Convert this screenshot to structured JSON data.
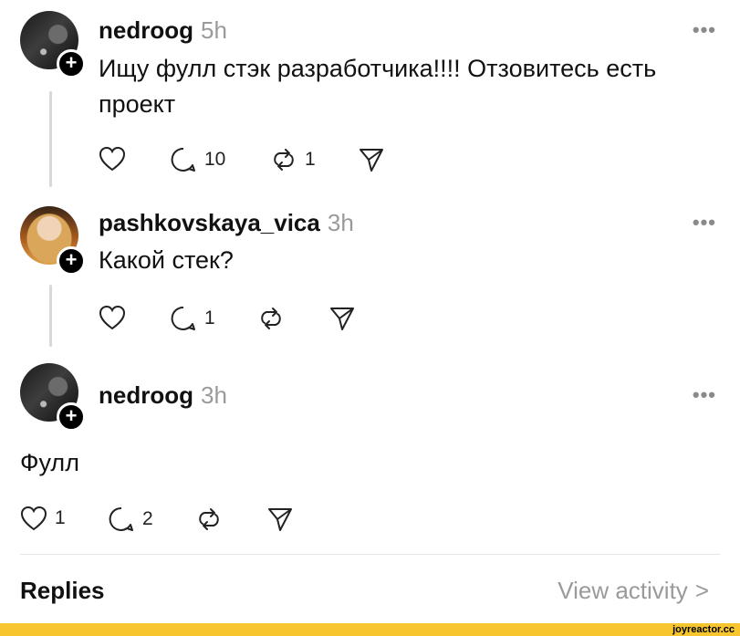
{
  "posts": [
    {
      "username": "nedroog",
      "time": "5h",
      "text": "Ищу фулл стэк разработчика!!!! Отзовитесь есть проект",
      "likes": "",
      "replies": "10",
      "reposts": "1"
    },
    {
      "username": "pashkovskaya_vica",
      "time": "3h",
      "text": "Какой стек?",
      "likes": "",
      "replies": "1",
      "reposts": ""
    },
    {
      "username": "nedroog",
      "time": "3h",
      "text": "Фулл",
      "likes": "1",
      "replies": "2",
      "reposts": ""
    }
  ],
  "more_label": "•••",
  "replies_section": {
    "title": "Replies",
    "view_activity": "View activity",
    "chevron": ">"
  },
  "watermark": "joyreactor.cc",
  "icons": {
    "follow": "plus-icon",
    "like": "heart-icon",
    "reply": "comment-icon",
    "repost": "repost-icon",
    "share": "send-icon",
    "more": "more-dots-icon"
  },
  "colors": {
    "accent": "#000000",
    "muted": "#9a9a9a",
    "footer": "#f7c62f"
  }
}
